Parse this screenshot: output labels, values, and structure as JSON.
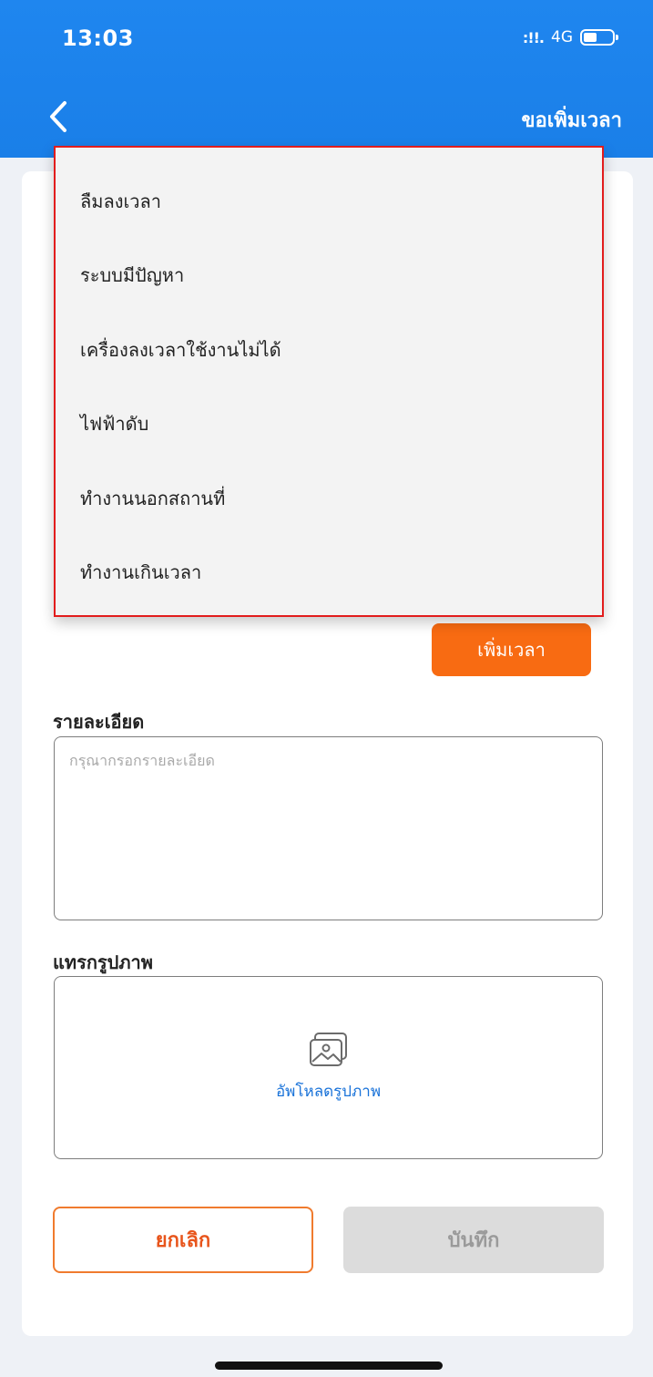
{
  "status_bar": {
    "time": "13:03",
    "network": "4G",
    "signal": ":!!."
  },
  "header": {
    "title": "ขอเพิ่มเวลา"
  },
  "dropdown": {
    "options": [
      "ลืมลงเวลา",
      "ระบบมีปัญหา",
      "เครื่องลงเวลาใช้งานไม่ได้",
      "ไฟฟ้าดับ",
      "ทำงานนอกสถานที่",
      "ทำงานเกินเวลา"
    ]
  },
  "add_time_label": "เพิ่มเวลา",
  "details": {
    "label": "รายละเอียด",
    "placeholder": "กรุณากรอกรายละเอียด"
  },
  "image": {
    "label": "แทรกรูปภาพ",
    "upload_text": "อัพโหลดรูปภาพ"
  },
  "actions": {
    "cancel_label": "ยกเลิก",
    "save_label": "บันทึก"
  },
  "colors": {
    "header_blue": "#1f86ef",
    "accent_orange": "#f86b12",
    "highlight_red": "#e21c1c",
    "link_blue": "#1a73d9"
  }
}
